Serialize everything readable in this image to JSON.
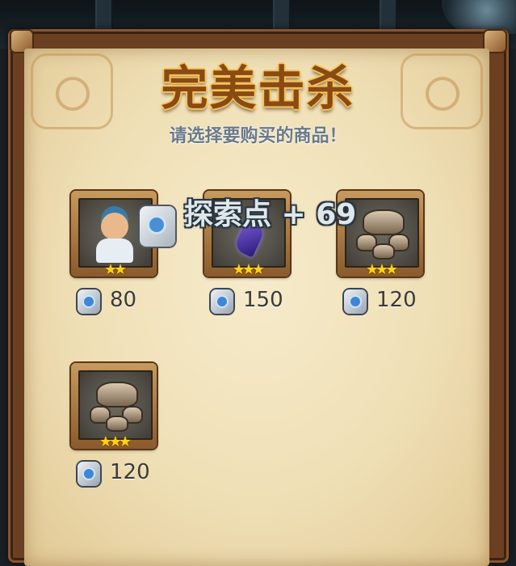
{
  "title": "完美击杀",
  "subtitle": "请选择要购买的商品！",
  "overlay": "探索点 + 69",
  "items": [
    {
      "name": "hero-card",
      "stars": "★★",
      "price": "80"
    },
    {
      "name": "crystal-shard",
      "stars": "★★★",
      "price": "150"
    },
    {
      "name": "claw-relic",
      "stars": "★★★",
      "price": "120"
    },
    {
      "name": "claw-relic",
      "stars": "★★★",
      "price": "120"
    }
  ],
  "colors": {
    "title": "#8a4a14",
    "title_outline": "#f4c35a",
    "parchment": "#efdfb5",
    "frame": "#6b3f22",
    "star": "#ffd21a",
    "gem": "#3e86d6"
  },
  "icons": {
    "currency": "blue-gem-token-icon",
    "rarity": "star-icon"
  }
}
